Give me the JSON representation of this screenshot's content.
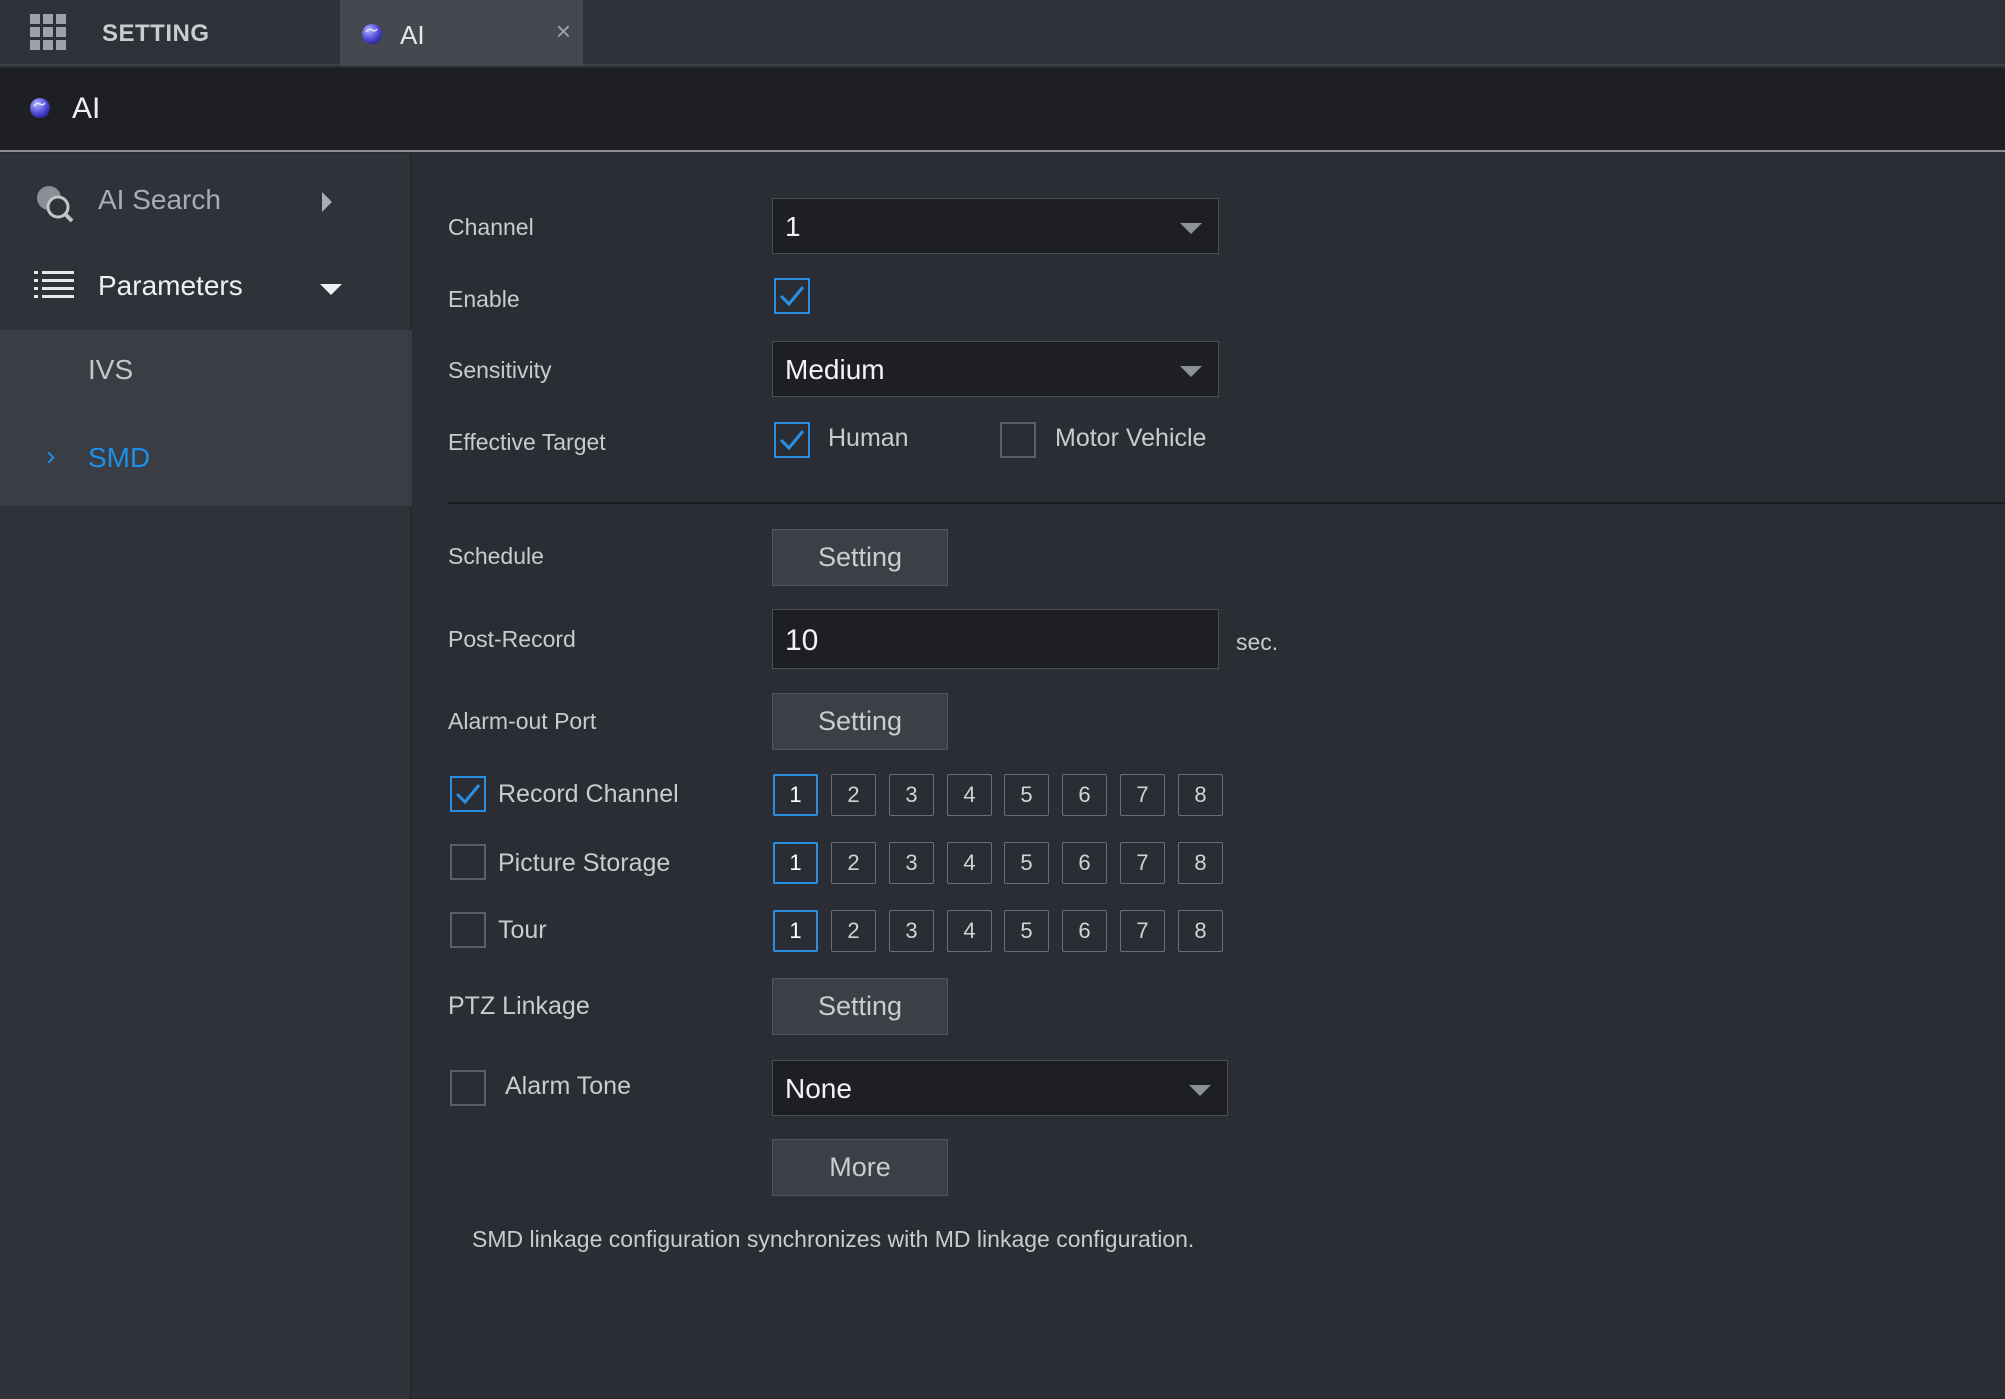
{
  "topbar": {
    "setting_label": "SETTING",
    "ai_tab_label": "AI",
    "close_glyph": "×",
    "menu_icon": "grid-icon",
    "ai_icon": "globe-icon"
  },
  "header": {
    "title": "AI"
  },
  "sidebar": {
    "items": [
      {
        "label": "AI Search",
        "icon": "ai-search-icon",
        "expanded": false
      },
      {
        "label": "Parameters",
        "icon": "list-icon",
        "expanded": true
      }
    ],
    "subitems": [
      {
        "label": "IVS",
        "active": false
      },
      {
        "label": "SMD",
        "active": true
      }
    ],
    "active_chevron": "›"
  },
  "form": {
    "channel": {
      "label": "Channel",
      "value": "1"
    },
    "enable": {
      "label": "Enable",
      "checked": true
    },
    "sensitivity": {
      "label": "Sensitivity",
      "value": "Medium"
    },
    "effective_target": {
      "label": "Effective Target",
      "human": {
        "label": "Human",
        "checked": true
      },
      "motor_vehicle": {
        "label": "Motor Vehicle",
        "checked": false
      }
    },
    "schedule": {
      "label": "Schedule",
      "button": "Setting"
    },
    "post_record": {
      "label": "Post-Record",
      "value": "10",
      "unit": "sec."
    },
    "alarm_out": {
      "label": "Alarm-out Port",
      "button": "Setting"
    },
    "record_channel": {
      "label": "Record Channel",
      "checked": true,
      "channels": [
        "1",
        "2",
        "3",
        "4",
        "5",
        "6",
        "7",
        "8"
      ],
      "selected": "1"
    },
    "picture_storage": {
      "label": "Picture Storage",
      "checked": false,
      "channels": [
        "1",
        "2",
        "3",
        "4",
        "5",
        "6",
        "7",
        "8"
      ],
      "selected": "1"
    },
    "tour": {
      "label": "Tour",
      "checked": false,
      "channels": [
        "1",
        "2",
        "3",
        "4",
        "5",
        "6",
        "7",
        "8"
      ],
      "selected": "1"
    },
    "ptz_linkage": {
      "label": "PTZ Linkage",
      "button": "Setting"
    },
    "alarm_tone": {
      "label": "Alarm Tone",
      "checked": false,
      "value": "None"
    },
    "more_button": "More",
    "note": "SMD linkage configuration synchronizes with MD linkage configuration."
  },
  "colors": {
    "accent": "#2a8fe0",
    "active_text": "#1e8fe8",
    "background": "#2a2d33"
  }
}
